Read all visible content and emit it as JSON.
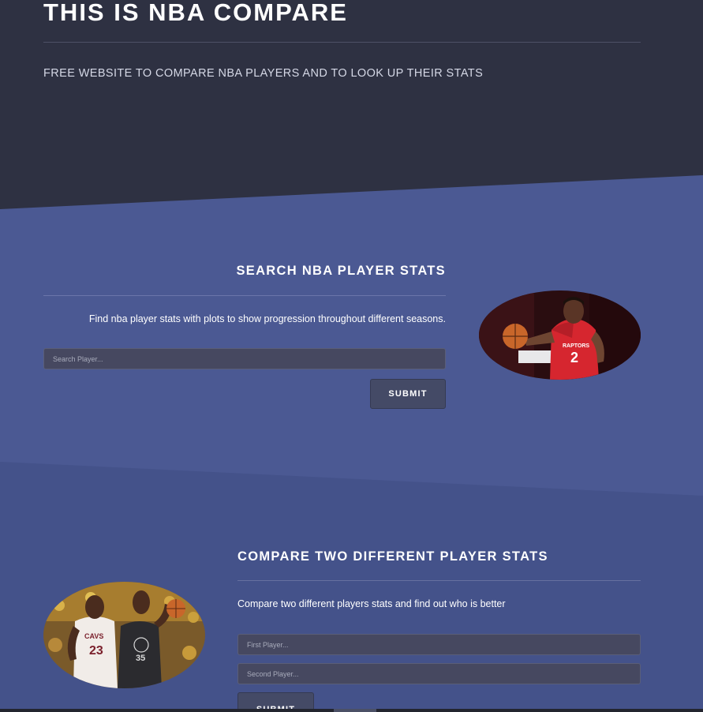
{
  "header": {
    "title": "THIS IS NBA COMPARE",
    "subtitle": "FREE WEBSITE TO COMPARE NBA PLAYERS AND TO LOOK UP THEIR STATS"
  },
  "search_section": {
    "heading": "SEARCH NBA PLAYER STATS",
    "description": "Find nba player stats with plots to show progression throughout different seasons.",
    "input_placeholder": "Search Player...",
    "input_value": "",
    "submit_label": "SUBMIT",
    "image": {
      "jersey_team": "RAPTORS",
      "jersey_number": "2"
    }
  },
  "compare_section": {
    "heading": "COMPARE TWO DIFFERENT PLAYER STATS",
    "description": "Compare two different players stats and find out who is better",
    "first_placeholder": "First Player...",
    "second_placeholder": "Second Player...",
    "first_value": "",
    "second_value": "",
    "submit_label": "SUBMIT",
    "image": {
      "jersey_left_team": "CAVS",
      "jersey_left_number": "23",
      "jersey_right_number": "35"
    }
  },
  "colors": {
    "header_bg": "#2e3142",
    "section1_bg": "#4b5993",
    "section2_bg": "#44528a",
    "input_bg": "#464860",
    "button_bg": "#444a66"
  }
}
